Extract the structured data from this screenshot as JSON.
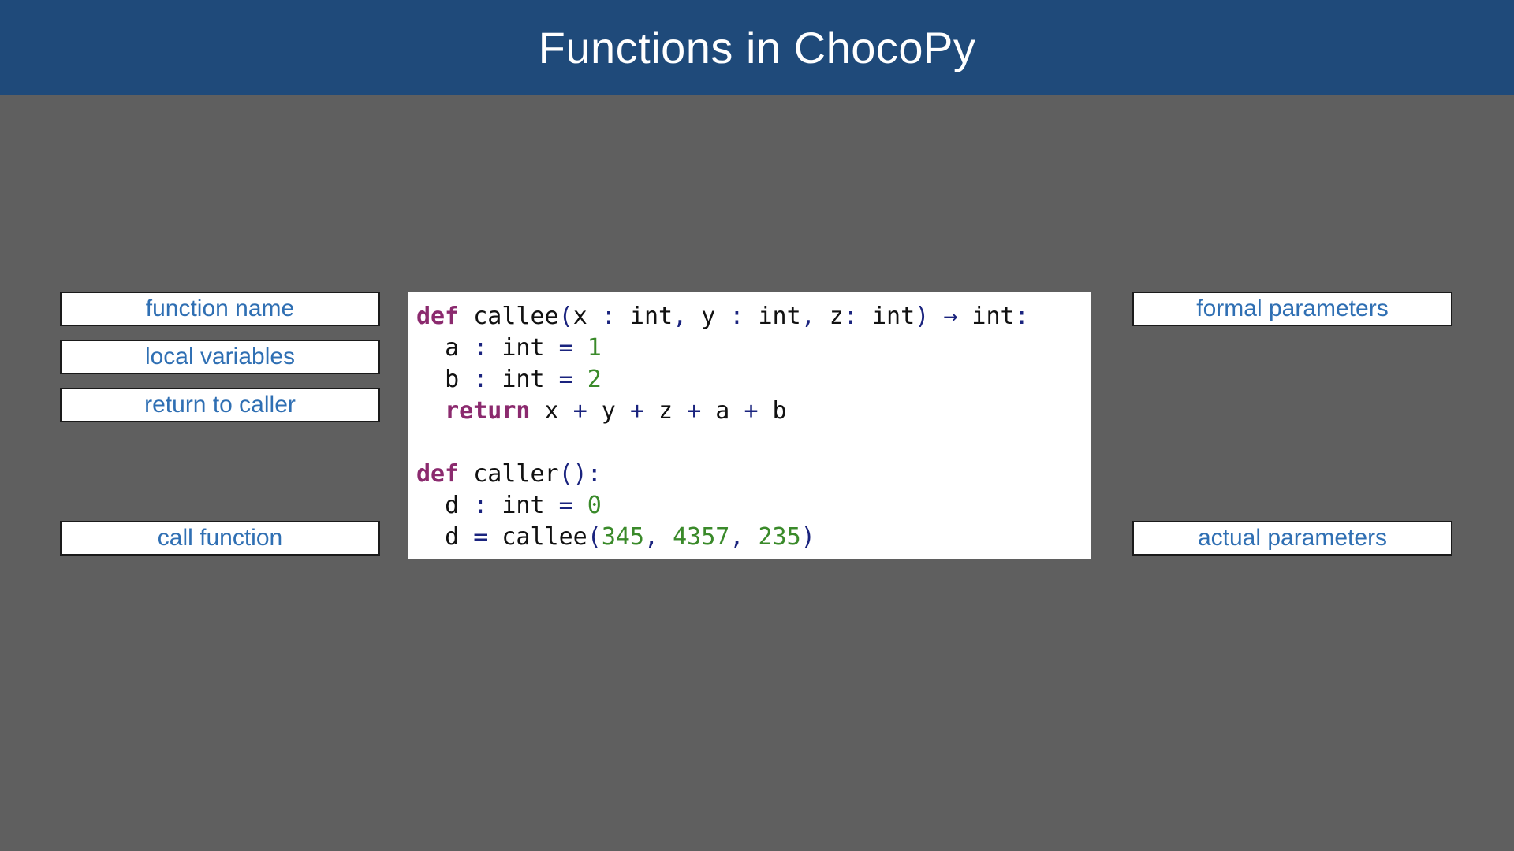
{
  "title": "Functions in ChocoPy",
  "left_labels": {
    "function_name": "function name",
    "local_variables": "local variables",
    "return_to_caller": "return to caller",
    "call_function": "call function"
  },
  "right_labels": {
    "formal_parameters": "formal parameters",
    "actual_parameters": "actual parameters"
  },
  "colors": {
    "title_bar": "#1f4a7a",
    "background": "#5f5f5f",
    "label_text": "#2f6fb3",
    "keyword": "#8b2a6e",
    "operator": "#1a237e",
    "number": "#3a8a2a"
  },
  "code": [
    [
      {
        "t": "def",
        "k": "kw"
      },
      {
        "t": " callee",
        "k": "plain"
      },
      {
        "t": "(",
        "k": "op"
      },
      {
        "t": "x ",
        "k": "plain"
      },
      {
        "t": ":",
        "k": "op"
      },
      {
        "t": " int",
        "k": "plain"
      },
      {
        "t": ",",
        "k": "op"
      },
      {
        "t": " y ",
        "k": "plain"
      },
      {
        "t": ":",
        "k": "op"
      },
      {
        "t": " int",
        "k": "plain"
      },
      {
        "t": ",",
        "k": "op"
      },
      {
        "t": " z",
        "k": "plain"
      },
      {
        "t": ":",
        "k": "op"
      },
      {
        "t": " int",
        "k": "plain"
      },
      {
        "t": ")",
        "k": "op"
      },
      {
        "t": " ",
        "k": "plain"
      },
      {
        "t": "→",
        "k": "op"
      },
      {
        "t": " int",
        "k": "plain"
      },
      {
        "t": ":",
        "k": "op"
      }
    ],
    [
      {
        "t": "  a ",
        "k": "plain"
      },
      {
        "t": ":",
        "k": "op"
      },
      {
        "t": " int ",
        "k": "plain"
      },
      {
        "t": "=",
        "k": "op"
      },
      {
        "t": " ",
        "k": "plain"
      },
      {
        "t": "1",
        "k": "num"
      }
    ],
    [
      {
        "t": "  b ",
        "k": "plain"
      },
      {
        "t": ":",
        "k": "op"
      },
      {
        "t": " int ",
        "k": "plain"
      },
      {
        "t": "=",
        "k": "op"
      },
      {
        "t": " ",
        "k": "plain"
      },
      {
        "t": "2",
        "k": "num"
      }
    ],
    [
      {
        "t": "  ",
        "k": "plain"
      },
      {
        "t": "return",
        "k": "kw"
      },
      {
        "t": " x ",
        "k": "plain"
      },
      {
        "t": "+",
        "k": "op"
      },
      {
        "t": " y ",
        "k": "plain"
      },
      {
        "t": "+",
        "k": "op"
      },
      {
        "t": " z ",
        "k": "plain"
      },
      {
        "t": "+",
        "k": "op"
      },
      {
        "t": " a ",
        "k": "plain"
      },
      {
        "t": "+",
        "k": "op"
      },
      {
        "t": " b",
        "k": "plain"
      }
    ],
    [],
    [
      {
        "t": "def",
        "k": "kw"
      },
      {
        "t": " caller",
        "k": "plain"
      },
      {
        "t": "():",
        "k": "op"
      }
    ],
    [
      {
        "t": "  d ",
        "k": "plain"
      },
      {
        "t": ":",
        "k": "op"
      },
      {
        "t": " int ",
        "k": "plain"
      },
      {
        "t": "=",
        "k": "op"
      },
      {
        "t": " ",
        "k": "plain"
      },
      {
        "t": "0",
        "k": "num"
      }
    ],
    [
      {
        "t": "  d ",
        "k": "plain"
      },
      {
        "t": "=",
        "k": "op"
      },
      {
        "t": " callee",
        "k": "plain"
      },
      {
        "t": "(",
        "k": "op"
      },
      {
        "t": "345",
        "k": "num"
      },
      {
        "t": ",",
        "k": "op"
      },
      {
        "t": " ",
        "k": "plain"
      },
      {
        "t": "4357",
        "k": "num"
      },
      {
        "t": ",",
        "k": "op"
      },
      {
        "t": " ",
        "k": "plain"
      },
      {
        "t": "235",
        "k": "num"
      },
      {
        "t": ")",
        "k": "op"
      }
    ]
  ]
}
